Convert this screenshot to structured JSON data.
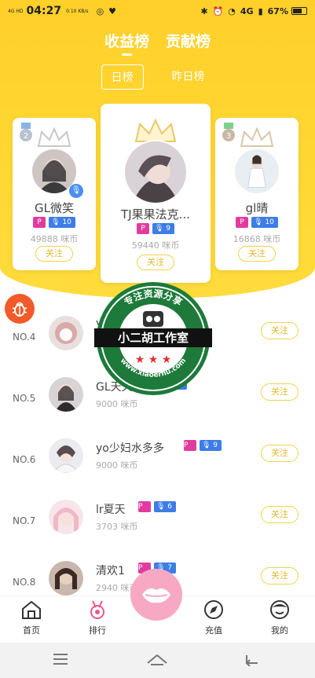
{
  "status": {
    "net_small": "4G HD",
    "time": "04:27",
    "speed": "0.10 KB/s",
    "battery": "67%",
    "signal": "4G"
  },
  "tabs": {
    "main": [
      "收益榜",
      "贡献榜"
    ],
    "sub": [
      "日榜",
      "昨日榜"
    ]
  },
  "top3": [
    {
      "rank_badge": "2",
      "name": "GL微笑",
      "level": "10",
      "coins": "49888 咪币",
      "follow": "关注"
    },
    {
      "rank_badge": "1",
      "name": "TJ果果法克...",
      "level": "9",
      "coins": "59440 咪币",
      "follow": "关注"
    },
    {
      "rank_badge": "3",
      "name": "gl晴",
      "level": "10",
      "coins": "16868 咪币",
      "follow": "关注"
    }
  ],
  "list": [
    {
      "rank": "NO.4",
      "name": "y",
      "level": "",
      "coins": "",
      "follow": "关注"
    },
    {
      "rank": "NO.5",
      "name": "GL天天",
      "level": "9",
      "coins": "9000 咪币",
      "follow": "关注"
    },
    {
      "rank": "NO.6",
      "name": "yo少妇水多多",
      "level": "9",
      "coins": "9000 咪币",
      "follow": "关注"
    },
    {
      "rank": "NO.7",
      "name": "lr夏天",
      "level": "6",
      "coins": "3703 咪币",
      "follow": "关注"
    },
    {
      "rank": "NO.8",
      "name": "清欢1",
      "level": "7",
      "coins": "2940 咪币",
      "follow": "关注"
    }
  ],
  "watermark": {
    "top": "专注资源分享",
    "middle": "小二胡工作室",
    "bottom": "www.xiaoerhu.com"
  },
  "tabbar": {
    "home": "首页",
    "rank": "排行",
    "recharge": "充值",
    "mine": "我的"
  },
  "colors": {
    "accent_yellow": "#ffd631",
    "badge_pink": "#e23ba0",
    "badge_blue": "#3c7de6",
    "follow_border": "#f2d24a",
    "bug_orange": "#f25a2a"
  }
}
